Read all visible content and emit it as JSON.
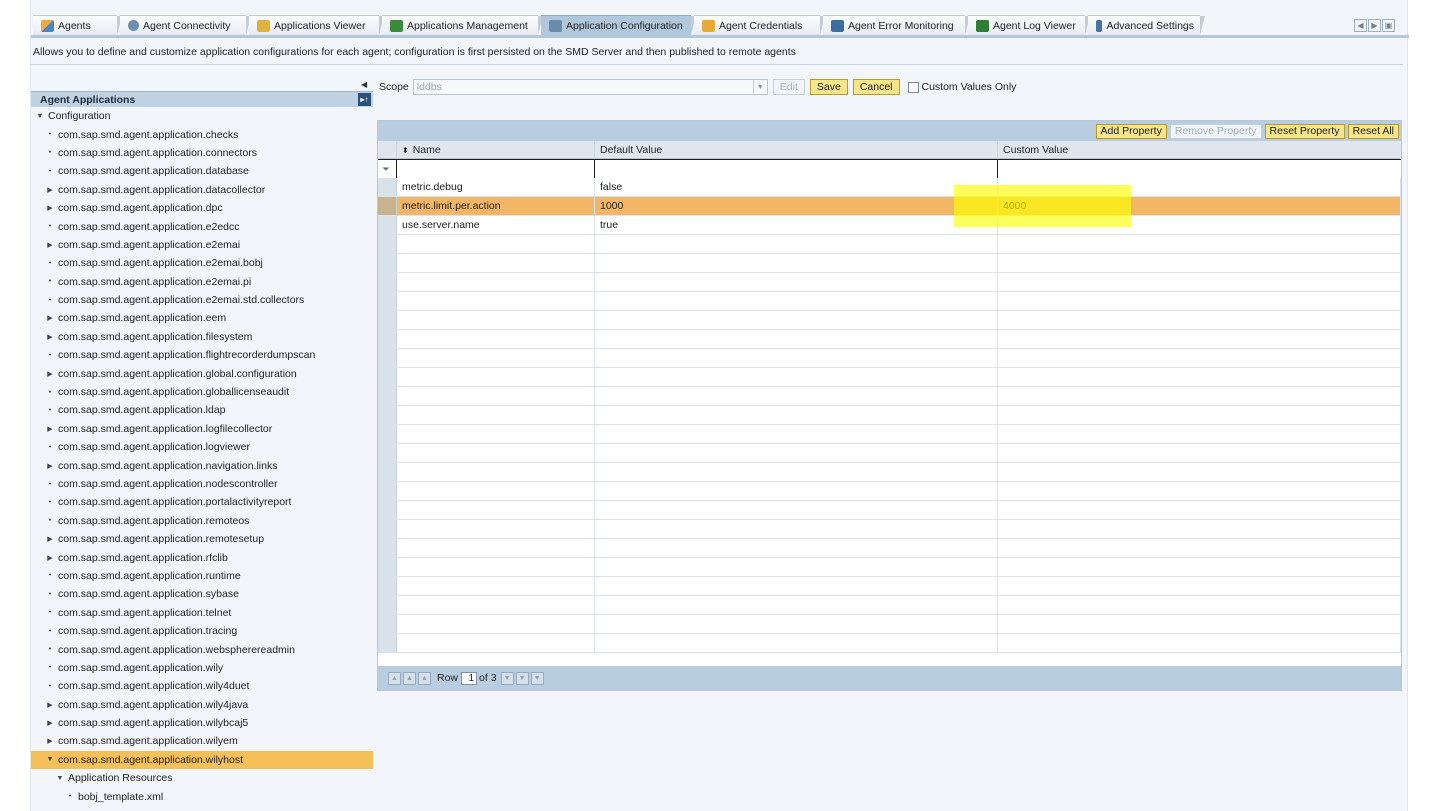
{
  "tabs": [
    {
      "label": "Agents",
      "icon": "agents-icon"
    },
    {
      "label": "Agent Connectivity",
      "icon": "connectivity-icon"
    },
    {
      "label": "Applications Viewer",
      "icon": "viewer-icon"
    },
    {
      "label": "Applications Management",
      "icon": "management-icon"
    },
    {
      "label": "Application Configuration",
      "icon": "configuration-icon",
      "active": true
    },
    {
      "label": "Agent Credentials",
      "icon": "credentials-icon"
    },
    {
      "label": "Agent Error Monitoring",
      "icon": "error-monitoring-icon"
    },
    {
      "label": "Agent Log Viewer",
      "icon": "log-viewer-icon"
    },
    {
      "label": "Advanced Settings",
      "icon": "advanced-settings-icon"
    }
  ],
  "description": "Allows you to define and customize application configurations for each agent; configuration is first persisted on the SMD Server and then published to remote agents",
  "tree": {
    "header": "Agent Applications",
    "items": [
      {
        "label": "Configuration",
        "level": 0,
        "mark": "▼"
      },
      {
        "label": "com.sap.smd.agent.application.checks",
        "level": 1,
        "mark": "•"
      },
      {
        "label": "com.sap.smd.agent.application.connectors",
        "level": 1,
        "mark": "•"
      },
      {
        "label": "com.sap.smd.agent.application.database",
        "level": 1,
        "mark": "•"
      },
      {
        "label": "com.sap.smd.agent.application.datacollector",
        "level": 1,
        "mark": "▶"
      },
      {
        "label": "com.sap.smd.agent.application.dpc",
        "level": 1,
        "mark": "▶"
      },
      {
        "label": "com.sap.smd.agent.application.e2edcc",
        "level": 1,
        "mark": "•"
      },
      {
        "label": "com.sap.smd.agent.application.e2emai",
        "level": 1,
        "mark": "▶"
      },
      {
        "label": "com.sap.smd.agent.application.e2emai.bobj",
        "level": 1,
        "mark": "•"
      },
      {
        "label": "com.sap.smd.agent.application.e2emai.pi",
        "level": 1,
        "mark": "•"
      },
      {
        "label": "com.sap.smd.agent.application.e2emai.std.collectors",
        "level": 1,
        "mark": "•"
      },
      {
        "label": "com.sap.smd.agent.application.eem",
        "level": 1,
        "mark": "▶"
      },
      {
        "label": "com.sap.smd.agent.application.filesystem",
        "level": 1,
        "mark": "▶"
      },
      {
        "label": "com.sap.smd.agent.application.flightrecorderdumpscan",
        "level": 1,
        "mark": "•"
      },
      {
        "label": "com.sap.smd.agent.application.global.configuration",
        "level": 1,
        "mark": "▶"
      },
      {
        "label": "com.sap.smd.agent.application.globallicenseaudit",
        "level": 1,
        "mark": "•"
      },
      {
        "label": "com.sap.smd.agent.application.ldap",
        "level": 1,
        "mark": "•"
      },
      {
        "label": "com.sap.smd.agent.application.logfilecollector",
        "level": 1,
        "mark": "▶"
      },
      {
        "label": "com.sap.smd.agent.application.logviewer",
        "level": 1,
        "mark": "•"
      },
      {
        "label": "com.sap.smd.agent.application.navigation.links",
        "level": 1,
        "mark": "▶"
      },
      {
        "label": "com.sap.smd.agent.application.nodescontroller",
        "level": 1,
        "mark": "•"
      },
      {
        "label": "com.sap.smd.agent.application.portalactivityreport",
        "level": 1,
        "mark": "•"
      },
      {
        "label": "com.sap.smd.agent.application.remoteos",
        "level": 1,
        "mark": "•"
      },
      {
        "label": "com.sap.smd.agent.application.remotesetup",
        "level": 1,
        "mark": "▶"
      },
      {
        "label": "com.sap.smd.agent.application.rfclib",
        "level": 1,
        "mark": "▶"
      },
      {
        "label": "com.sap.smd.agent.application.runtime",
        "level": 1,
        "mark": "•"
      },
      {
        "label": "com.sap.smd.agent.application.sybase",
        "level": 1,
        "mark": "•"
      },
      {
        "label": "com.sap.smd.agent.application.telnet",
        "level": 1,
        "mark": "•"
      },
      {
        "label": "com.sap.smd.agent.application.tracing",
        "level": 1,
        "mark": "•"
      },
      {
        "label": "com.sap.smd.agent.application.webspherereadmin",
        "level": 1,
        "mark": "•"
      },
      {
        "label": "com.sap.smd.agent.application.wily",
        "level": 1,
        "mark": "•"
      },
      {
        "label": "com.sap.smd.agent.application.wily4duet",
        "level": 1,
        "mark": "•"
      },
      {
        "label": "com.sap.smd.agent.application.wily4java",
        "level": 1,
        "mark": "▶"
      },
      {
        "label": "com.sap.smd.agent.application.wilybcaj5",
        "level": 1,
        "mark": "▶"
      },
      {
        "label": "com.sap.smd.agent.application.wilyem",
        "level": 1,
        "mark": "▶"
      },
      {
        "label": "com.sap.smd.agent.application.wilyhost",
        "level": 1,
        "mark": "▼",
        "selected": true
      },
      {
        "label": "Application Resources",
        "level": 2,
        "mark": "▼"
      },
      {
        "label": "bobj_template.xml",
        "level": 3,
        "mark": "•"
      }
    ]
  },
  "scope": {
    "label": "Scope",
    "value": "lddbs",
    "buttons": {
      "edit": "Edit",
      "save": "Save",
      "cancel": "Cancel"
    },
    "custom_only": "Custom Values Only"
  },
  "table": {
    "toolbar": {
      "add": "Add Property",
      "remove": "Remove Property",
      "reset": "Reset Property",
      "reset_all": "Reset All"
    },
    "columns": {
      "name": "Name",
      "default": "Default Value",
      "custom": "Custom Value"
    },
    "rows": [
      {
        "name": "metric.debug",
        "default": "false",
        "custom": ""
      },
      {
        "name": "metric.limit.per.action",
        "default": "1000",
        "custom": "4000",
        "highlighted": true
      },
      {
        "name": "use.server.name",
        "default": "true",
        "custom": ""
      }
    ],
    "pager": {
      "label": "Row",
      "current": "1",
      "of": "of 3"
    },
    "colors": {
      "highlight_row": "#f2b766",
      "annotation": "#ffff00"
    }
  }
}
